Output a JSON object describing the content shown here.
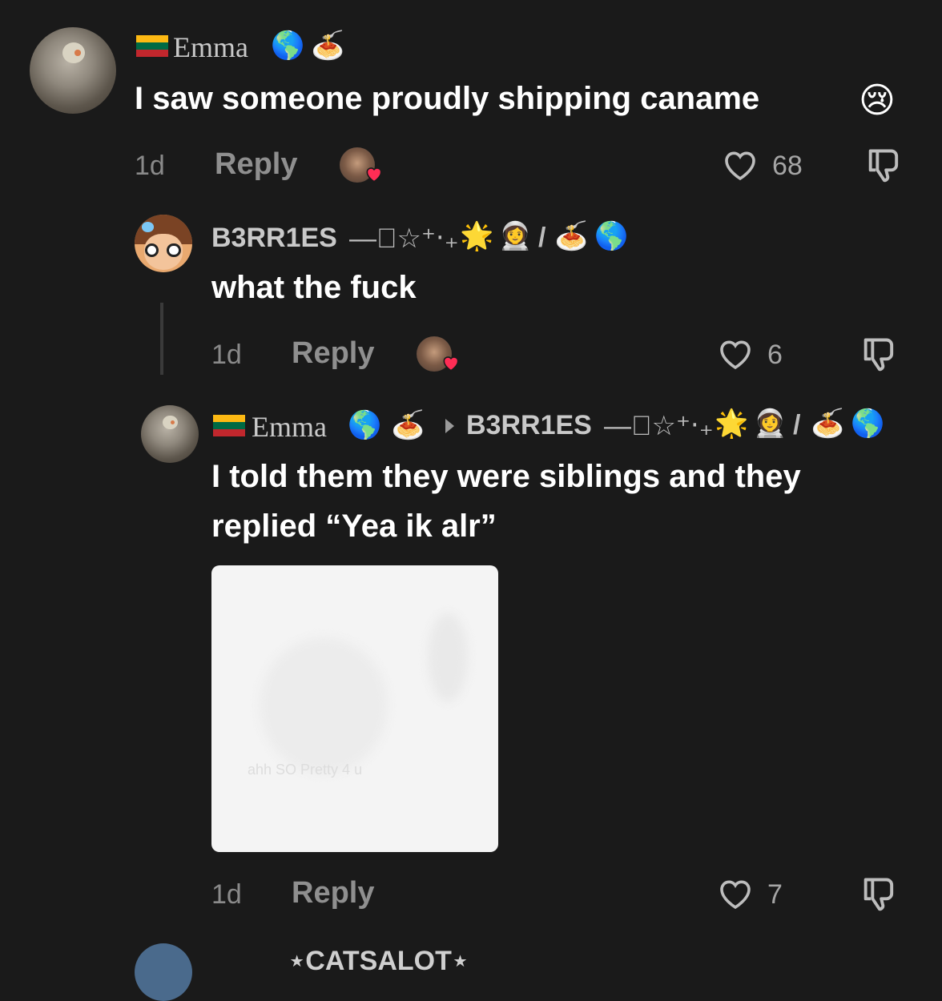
{
  "comments": [
    {
      "username": "Emma",
      "text": "I saw someone proudly shipping caname",
      "time": "1d",
      "reply_label": "Reply",
      "likes": "68"
    },
    {
      "username": "B3RR1ES",
      "username_decor": "—⃨☆⁺‧₊",
      "text": "what the fuck",
      "time": "1d",
      "reply_label": "Reply",
      "likes": "6"
    },
    {
      "username": "Emma",
      "reply_to": "B3RR1ES",
      "reply_to_decor": "—⃨☆⁺‧₊",
      "text_line1": "I told them they were siblings and they",
      "text_line2": "replied “Yea ik alr”",
      "image_caption": "ahh SO Pretty 4 u",
      "time": "1d",
      "reply_label": "Reply",
      "likes": "7"
    }
  ],
  "next_comment_partial": {
    "username": "⋆CATSALOT⋆"
  },
  "icons": {
    "heart": "heart-outline-icon",
    "dislike": "thumbs-down-icon",
    "emoji_earth": "🌎",
    "emoji_spaghetti": "🍝",
    "emoji_cry": "😢",
    "emoji_star_frame": "🌟",
    "emoji_astronaut": "👩‍🚀",
    "slash": "/"
  },
  "colors": {
    "background": "#1a1a1a",
    "text": "#ffffff",
    "muted": "#8a8a8a",
    "heart_badge": "#ff2d55"
  }
}
